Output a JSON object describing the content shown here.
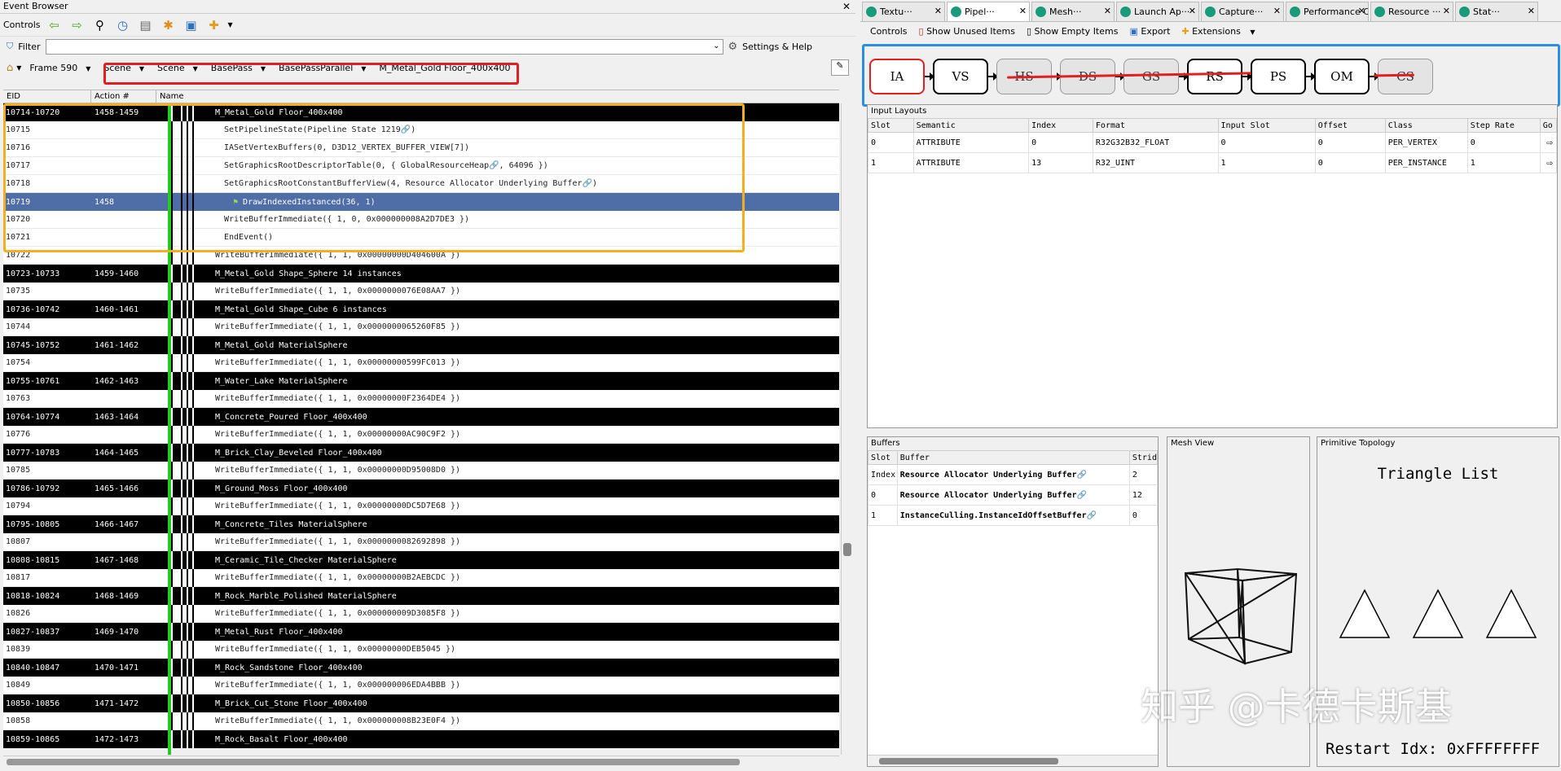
{
  "event_browser": {
    "title": "Event Browser",
    "close": "✕",
    "controls_label": "Controls",
    "filter_label": "Filter",
    "filter_value": "",
    "settings_label": "Settings & Help",
    "breadcrumbs": [
      "Frame 590",
      "Scene",
      "Scene",
      "BasePass",
      "BasePassParallel",
      "M_Metal_Gold Floor_400x400"
    ],
    "columns": [
      "EID",
      "Action #",
      "Name"
    ],
    "rows": [
      {
        "eid": "10714-10720",
        "act": "1458-1459",
        "name": "M_Metal_Gold Floor_400x400",
        "style": "dark",
        "indent": 0
      },
      {
        "eid": "10715",
        "act": "",
        "name": "SetPipelineState(Pipeline State 1219🔗)",
        "style": "light",
        "indent": 1
      },
      {
        "eid": "10716",
        "act": "",
        "name": "IASetVertexBuffers(0, D3D12_VERTEX_BUFFER_VIEW[7])",
        "style": "light",
        "indent": 1
      },
      {
        "eid": "10717",
        "act": "",
        "name": "SetGraphicsRootDescriptorTable(0,  {  GlobalResourceHeap🔗,  64096  })",
        "style": "light",
        "indent": 1
      },
      {
        "eid": "10718",
        "act": "",
        "name": "SetGraphicsRootConstantBufferView(4,  Resource Allocator Underlying Buffer🔗)",
        "style": "light",
        "indent": 1
      },
      {
        "eid": "10719",
        "act": "1458",
        "name": "DrawIndexedInstanced(36, 1)",
        "style": "sel",
        "indent": 2
      },
      {
        "eid": "10720",
        "act": "",
        "name": "WriteBufferImmediate({ 1, 0, 0x000000008A2D7DE3 })",
        "style": "light",
        "indent": 1
      },
      {
        "eid": "10721",
        "act": "",
        "name": "EndEvent()",
        "style": "light",
        "indent": 1
      },
      {
        "eid": "10722",
        "act": "",
        "name": "WriteBufferImmediate({ 1, 1, 0x00000000D404600A })",
        "style": "light",
        "indent": 0
      },
      {
        "eid": "10723-10733",
        "act": "1459-1460",
        "name": "M_Metal_Gold Shape_Sphere 14 instances",
        "style": "dark",
        "indent": 0
      },
      {
        "eid": "10735",
        "act": "",
        "name": "WriteBufferImmediate({ 1, 1, 0x0000000076E08AA7 })",
        "style": "light",
        "indent": 0
      },
      {
        "eid": "10736-10742",
        "act": "1460-1461",
        "name": "M_Metal_Gold Shape_Cube 6 instances",
        "style": "dark",
        "indent": 0
      },
      {
        "eid": "10744",
        "act": "",
        "name": "WriteBufferImmediate({ 1, 1, 0x0000000065260F85 })",
        "style": "light",
        "indent": 0
      },
      {
        "eid": "10745-10752",
        "act": "1461-1462",
        "name": "M_Metal_Gold MaterialSphere",
        "style": "dark",
        "indent": 0
      },
      {
        "eid": "10754",
        "act": "",
        "name": "WriteBufferImmediate({ 1, 1, 0x00000000599FC013 })",
        "style": "light",
        "indent": 0
      },
      {
        "eid": "10755-10761",
        "act": "1462-1463",
        "name": "M_Water_Lake MaterialSphere",
        "style": "dark",
        "indent": 0
      },
      {
        "eid": "10763",
        "act": "",
        "name": "WriteBufferImmediate({ 1, 1, 0x00000000F2364DE4 })",
        "style": "light",
        "indent": 0
      },
      {
        "eid": "10764-10774",
        "act": "1463-1464",
        "name": "M_Concrete_Poured Floor_400x400",
        "style": "dark",
        "indent": 0
      },
      {
        "eid": "10776",
        "act": "",
        "name": "WriteBufferImmediate({ 1, 1, 0x00000000AC90C9F2 })",
        "style": "light",
        "indent": 0
      },
      {
        "eid": "10777-10783",
        "act": "1464-1465",
        "name": "M_Brick_Clay_Beveled Floor_400x400",
        "style": "dark",
        "indent": 0
      },
      {
        "eid": "10785",
        "act": "",
        "name": "WriteBufferImmediate({ 1, 1, 0x00000000D95008D0 })",
        "style": "light",
        "indent": 0
      },
      {
        "eid": "10786-10792",
        "act": "1465-1466",
        "name": "M_Ground_Moss Floor_400x400",
        "style": "dark",
        "indent": 0
      },
      {
        "eid": "10794",
        "act": "",
        "name": "WriteBufferImmediate({ 1, 1, 0x00000000DC5D7E68 })",
        "style": "light",
        "indent": 0
      },
      {
        "eid": "10795-10805",
        "act": "1466-1467",
        "name": "M_Concrete_Tiles MaterialSphere",
        "style": "dark",
        "indent": 0
      },
      {
        "eid": "10807",
        "act": "",
        "name": "WriteBufferImmediate({ 1, 1, 0x0000000082692898 })",
        "style": "light",
        "indent": 0
      },
      {
        "eid": "10808-10815",
        "act": "1467-1468",
        "name": "M_Ceramic_Tile_Checker MaterialSphere",
        "style": "dark",
        "indent": 0
      },
      {
        "eid": "10817",
        "act": "",
        "name": "WriteBufferImmediate({ 1, 1, 0x00000000B2AEBCDC })",
        "style": "light",
        "indent": 0
      },
      {
        "eid": "10818-10824",
        "act": "1468-1469",
        "name": "M_Rock_Marble_Polished MaterialSphere",
        "style": "dark",
        "indent": 0
      },
      {
        "eid": "10826",
        "act": "",
        "name": "WriteBufferImmediate({ 1, 1, 0x000000009D3085F8 })",
        "style": "light",
        "indent": 0
      },
      {
        "eid": "10827-10837",
        "act": "1469-1470",
        "name": "M_Metal_Rust Floor_400x400",
        "style": "dark",
        "indent": 0
      },
      {
        "eid": "10839",
        "act": "",
        "name": "WriteBufferImmediate({ 1, 1, 0x00000000DEB5045 })",
        "style": "light",
        "indent": 0
      },
      {
        "eid": "10840-10847",
        "act": "1470-1471",
        "name": "M_Rock_Sandstone Floor_400x400",
        "style": "dark",
        "indent": 0
      },
      {
        "eid": "10849",
        "act": "",
        "name": "WriteBufferImmediate({ 1, 1, 0x000000006EDA4BBB })",
        "style": "light",
        "indent": 0
      },
      {
        "eid": "10850-10856",
        "act": "1471-1472",
        "name": "M_Brick_Cut_Stone Floor_400x400",
        "style": "dark",
        "indent": 0
      },
      {
        "eid": "10858",
        "act": "",
        "name": "WriteBufferImmediate({ 1, 1, 0x000000008B23E0F4 })",
        "style": "light",
        "indent": 0
      },
      {
        "eid": "10859-10865",
        "act": "1472-1473",
        "name": "M_Rock_Basalt Floor_400x400",
        "style": "dark",
        "indent": 0
      }
    ]
  },
  "tabs": [
    {
      "label": "Textu···",
      "active": false
    },
    {
      "label": "Pipel···",
      "active": true
    },
    {
      "label": "Mesh···",
      "active": false
    },
    {
      "label": "Launch Ap···",
      "active": false
    },
    {
      "label": "Capture···",
      "active": false
    },
    {
      "label": "Performance Count···",
      "active": false
    },
    {
      "label": "Resource ···",
      "active": false
    },
    {
      "label": "Stat···",
      "active": false
    }
  ],
  "pipeline_toolbar": {
    "controls": "Controls",
    "show_unused": "Show Unused Items",
    "show_empty": "Show Empty Items",
    "export": "Export",
    "extensions": "Extensions"
  },
  "stages": [
    {
      "label": "IA",
      "on": true
    },
    {
      "label": "VS",
      "on": true
    },
    {
      "label": "HS",
      "on": false
    },
    {
      "label": "DS",
      "on": false
    },
    {
      "label": "GS",
      "on": false
    },
    {
      "label": "RS",
      "on": true
    },
    {
      "label": "PS",
      "on": true
    },
    {
      "label": "OM",
      "on": true
    },
    {
      "label": "CS",
      "on": false
    }
  ],
  "input_layouts": {
    "title": "Input Layouts",
    "columns": [
      "Slot",
      "Semantic",
      "Index",
      "Format",
      "Input Slot",
      "Offset",
      "Class",
      "Step Rate",
      "Go"
    ],
    "rows": [
      [
        "0",
        "ATTRIBUTE",
        "0",
        "R32G32B32_FLOAT",
        "0",
        "0",
        "PER_VERTEX",
        "0"
      ],
      [
        "1",
        "ATTRIBUTE",
        "13",
        "R32_UINT",
        "1",
        "0",
        "PER_INSTANCE",
        "1"
      ]
    ]
  },
  "buffers": {
    "title": "Buffers",
    "columns": [
      "Slot",
      "Buffer",
      "Strid"
    ],
    "rows": [
      [
        "Index",
        "Resource Allocator Underlying Buffer🔗",
        "2"
      ],
      [
        "0",
        "Resource Allocator Underlying Buffer🔗",
        "12"
      ],
      [
        "1",
        "InstanceCulling.InstanceIdOffsetBuffer🔗",
        "0"
      ]
    ]
  },
  "mesh_view": {
    "title": "Mesh View"
  },
  "topology": {
    "title": "Primitive Topology",
    "value": "Triangle List",
    "restart": "Restart Idx: 0xFFFFFFFF"
  },
  "watermark": "知乎 @卡德卡斯基",
  "colors": {
    "selected_row": "#4f6ea8",
    "highlight_red": "#e02020",
    "highlight_yellow": "#f2b020",
    "highlight_blue": "#2a8fe0",
    "timeline_green": "#22cc22"
  }
}
